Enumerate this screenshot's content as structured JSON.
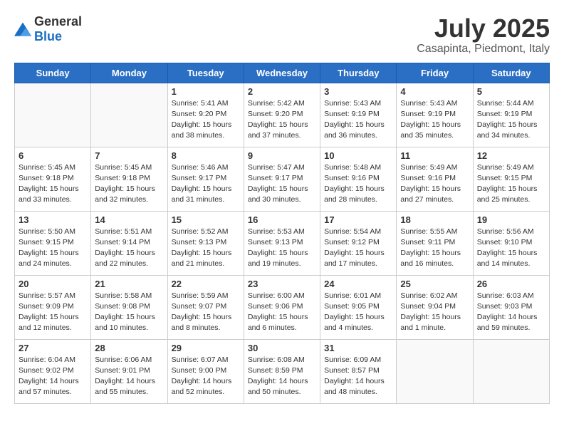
{
  "logo": {
    "general": "General",
    "blue": "Blue"
  },
  "title": "July 2025",
  "location": "Casapinta, Piedmont, Italy",
  "weekdays": [
    "Sunday",
    "Monday",
    "Tuesday",
    "Wednesday",
    "Thursday",
    "Friday",
    "Saturday"
  ],
  "weeks": [
    [
      {
        "day": "",
        "info": ""
      },
      {
        "day": "",
        "info": ""
      },
      {
        "day": "1",
        "info": "Sunrise: 5:41 AM\nSunset: 9:20 PM\nDaylight: 15 hours\nand 38 minutes."
      },
      {
        "day": "2",
        "info": "Sunrise: 5:42 AM\nSunset: 9:20 PM\nDaylight: 15 hours\nand 37 minutes."
      },
      {
        "day": "3",
        "info": "Sunrise: 5:43 AM\nSunset: 9:19 PM\nDaylight: 15 hours\nand 36 minutes."
      },
      {
        "day": "4",
        "info": "Sunrise: 5:43 AM\nSunset: 9:19 PM\nDaylight: 15 hours\nand 35 minutes."
      },
      {
        "day": "5",
        "info": "Sunrise: 5:44 AM\nSunset: 9:19 PM\nDaylight: 15 hours\nand 34 minutes."
      }
    ],
    [
      {
        "day": "6",
        "info": "Sunrise: 5:45 AM\nSunset: 9:18 PM\nDaylight: 15 hours\nand 33 minutes."
      },
      {
        "day": "7",
        "info": "Sunrise: 5:45 AM\nSunset: 9:18 PM\nDaylight: 15 hours\nand 32 minutes."
      },
      {
        "day": "8",
        "info": "Sunrise: 5:46 AM\nSunset: 9:17 PM\nDaylight: 15 hours\nand 31 minutes."
      },
      {
        "day": "9",
        "info": "Sunrise: 5:47 AM\nSunset: 9:17 PM\nDaylight: 15 hours\nand 30 minutes."
      },
      {
        "day": "10",
        "info": "Sunrise: 5:48 AM\nSunset: 9:16 PM\nDaylight: 15 hours\nand 28 minutes."
      },
      {
        "day": "11",
        "info": "Sunrise: 5:49 AM\nSunset: 9:16 PM\nDaylight: 15 hours\nand 27 minutes."
      },
      {
        "day": "12",
        "info": "Sunrise: 5:49 AM\nSunset: 9:15 PM\nDaylight: 15 hours\nand 25 minutes."
      }
    ],
    [
      {
        "day": "13",
        "info": "Sunrise: 5:50 AM\nSunset: 9:15 PM\nDaylight: 15 hours\nand 24 minutes."
      },
      {
        "day": "14",
        "info": "Sunrise: 5:51 AM\nSunset: 9:14 PM\nDaylight: 15 hours\nand 22 minutes."
      },
      {
        "day": "15",
        "info": "Sunrise: 5:52 AM\nSunset: 9:13 PM\nDaylight: 15 hours\nand 21 minutes."
      },
      {
        "day": "16",
        "info": "Sunrise: 5:53 AM\nSunset: 9:13 PM\nDaylight: 15 hours\nand 19 minutes."
      },
      {
        "day": "17",
        "info": "Sunrise: 5:54 AM\nSunset: 9:12 PM\nDaylight: 15 hours\nand 17 minutes."
      },
      {
        "day": "18",
        "info": "Sunrise: 5:55 AM\nSunset: 9:11 PM\nDaylight: 15 hours\nand 16 minutes."
      },
      {
        "day": "19",
        "info": "Sunrise: 5:56 AM\nSunset: 9:10 PM\nDaylight: 15 hours\nand 14 minutes."
      }
    ],
    [
      {
        "day": "20",
        "info": "Sunrise: 5:57 AM\nSunset: 9:09 PM\nDaylight: 15 hours\nand 12 minutes."
      },
      {
        "day": "21",
        "info": "Sunrise: 5:58 AM\nSunset: 9:08 PM\nDaylight: 15 hours\nand 10 minutes."
      },
      {
        "day": "22",
        "info": "Sunrise: 5:59 AM\nSunset: 9:07 PM\nDaylight: 15 hours\nand 8 minutes."
      },
      {
        "day": "23",
        "info": "Sunrise: 6:00 AM\nSunset: 9:06 PM\nDaylight: 15 hours\nand 6 minutes."
      },
      {
        "day": "24",
        "info": "Sunrise: 6:01 AM\nSunset: 9:05 PM\nDaylight: 15 hours\nand 4 minutes."
      },
      {
        "day": "25",
        "info": "Sunrise: 6:02 AM\nSunset: 9:04 PM\nDaylight: 15 hours\nand 1 minute."
      },
      {
        "day": "26",
        "info": "Sunrise: 6:03 AM\nSunset: 9:03 PM\nDaylight: 14 hours\nand 59 minutes."
      }
    ],
    [
      {
        "day": "27",
        "info": "Sunrise: 6:04 AM\nSunset: 9:02 PM\nDaylight: 14 hours\nand 57 minutes."
      },
      {
        "day": "28",
        "info": "Sunrise: 6:06 AM\nSunset: 9:01 PM\nDaylight: 14 hours\nand 55 minutes."
      },
      {
        "day": "29",
        "info": "Sunrise: 6:07 AM\nSunset: 9:00 PM\nDaylight: 14 hours\nand 52 minutes."
      },
      {
        "day": "30",
        "info": "Sunrise: 6:08 AM\nSunset: 8:59 PM\nDaylight: 14 hours\nand 50 minutes."
      },
      {
        "day": "31",
        "info": "Sunrise: 6:09 AM\nSunset: 8:57 PM\nDaylight: 14 hours\nand 48 minutes."
      },
      {
        "day": "",
        "info": ""
      },
      {
        "day": "",
        "info": ""
      }
    ]
  ]
}
